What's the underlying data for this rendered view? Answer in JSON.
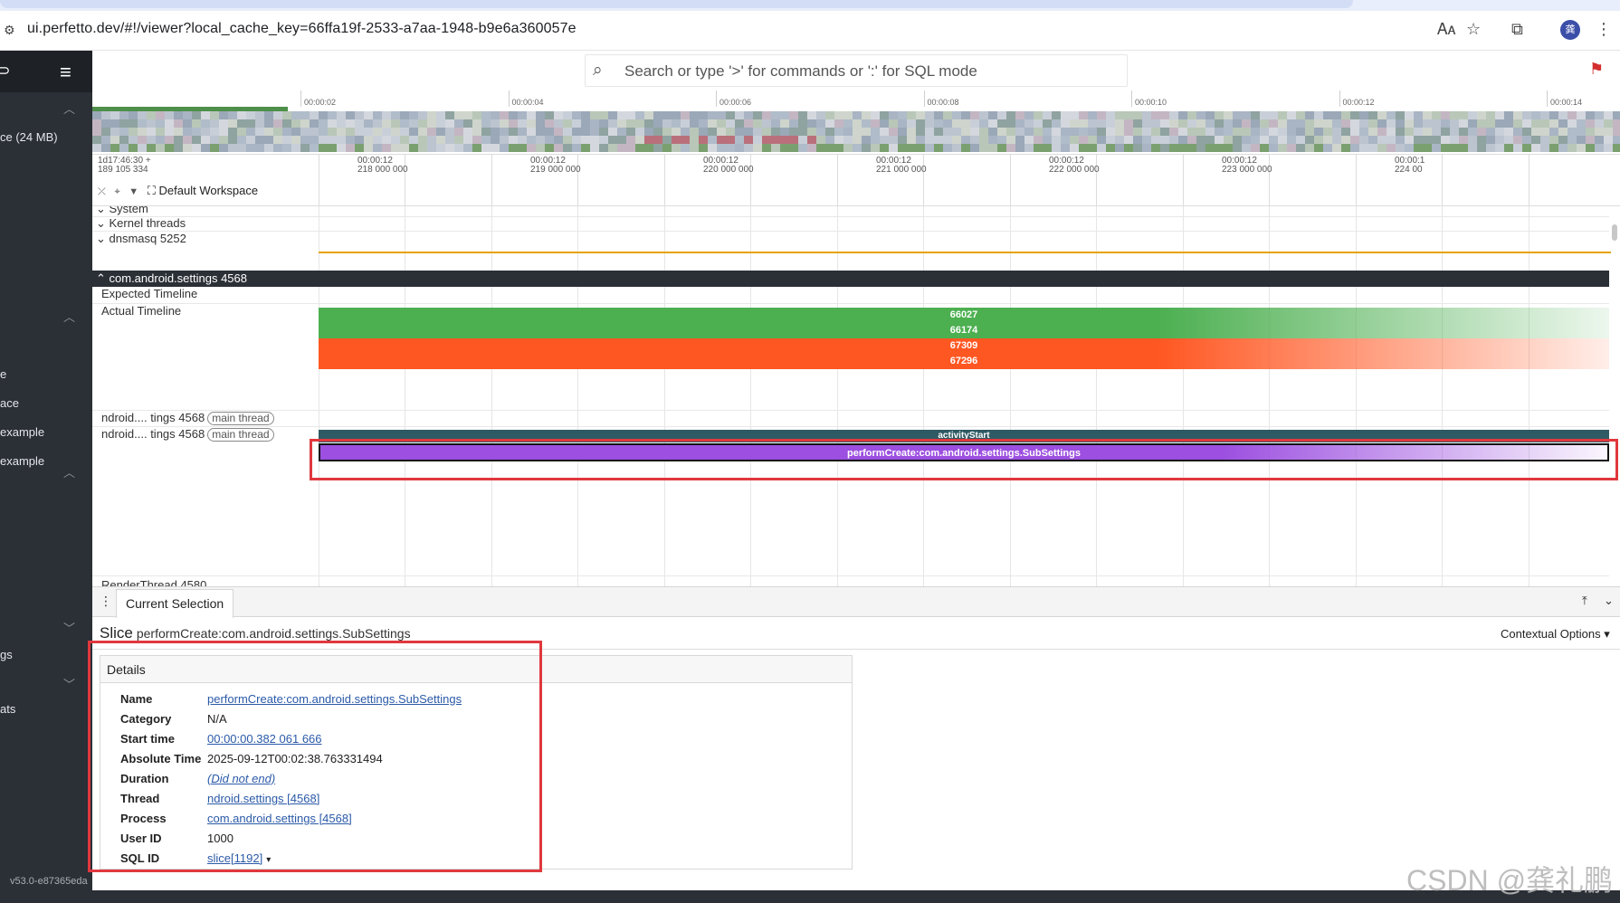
{
  "browser": {
    "url": "ui.perfetto.dev/#!/viewer?local_cache_key=66ffa19f-2533-a7aa-1948-b9e6a360057e",
    "avatar_letter": "龚"
  },
  "sidebar": {
    "items": [
      {
        "label": "ce (24 MB)"
      },
      {
        "label": "e"
      },
      {
        "label": "ace"
      },
      {
        "label": "example"
      },
      {
        "label": "example"
      },
      {
        "label": "gs"
      },
      {
        "label": "ats"
      }
    ],
    "version": "v53.0-e87365eda"
  },
  "omnibox": {
    "placeholder": "Search or type '>' for commands or ':' for SQL mode"
  },
  "overview": {
    "ticks": [
      "00:00:02",
      "00:00:04",
      "00:00:06",
      "00:00:08",
      "00:00:10",
      "00:00:12",
      "00:00:14"
    ]
  },
  "timeaxis": {
    "origin_line1": "1d17:46:30 +",
    "origin_line2": "189 105 334",
    "ticks": [
      {
        "l1": "00:00:12",
        "l2": "218 000 000"
      },
      {
        "l1": "00:00:12",
        "l2": "219 000 000"
      },
      {
        "l1": "00:00:12",
        "l2": "220 000 000"
      },
      {
        "l1": "00:00:12",
        "l2": "221 000 000"
      },
      {
        "l1": "00:00:12",
        "l2": "222 000 000"
      },
      {
        "l1": "00:00:12",
        "l2": "223 000 000"
      },
      {
        "l1": "00:00:1",
        "l2": "224 00"
      }
    ],
    "workspace": "Default Workspace"
  },
  "tracks": {
    "system": "System",
    "kernel": "Kernel threads",
    "dnsmasq": "dnsmasq 5252",
    "process": "com.android.settings 4568",
    "expected": "Expected Timeline",
    "actual": "Actual Timeline",
    "actual_slices": [
      "66027",
      "66174",
      "67309",
      "67296"
    ],
    "thread1": "ndroid.... tings 4568",
    "thread2": "ndroid.... tings 4568",
    "thread_pill": "main thread",
    "activity_slice": "activityStart",
    "perform_slice": "performCreate:com.android.settings.SubSettings",
    "render_thread": "RenderThread 4580"
  },
  "details": {
    "tab": "Current Selection",
    "slice_word": "Slice",
    "slice_name": "performCreate:com.android.settings.SubSettings",
    "contextual": "Contextual Options",
    "card_title": "Details",
    "rows": [
      {
        "k": "Name",
        "v": "performCreate:com.android.settings.SubSettings",
        "link": true
      },
      {
        "k": "Category",
        "v": "N/A",
        "link": false
      },
      {
        "k": "Start time",
        "v": "00:00:00.382 061 666",
        "link": true
      },
      {
        "k": "Absolute Time",
        "v": "2025-09-12T00:02:38.763331494",
        "link": false
      },
      {
        "k": "Duration",
        "v": "(Did not end)",
        "link": true,
        "italic": true
      },
      {
        "k": "Thread",
        "v": "ndroid.settings [4568]",
        "link": true
      },
      {
        "k": "Process",
        "v": "com.android.settings [4568]",
        "link": true
      },
      {
        "k": "User ID",
        "v": "1000",
        "link": false
      },
      {
        "k": "SQL ID",
        "v": "slice[1192]",
        "link": true,
        "dropdown": "▾"
      }
    ]
  },
  "watermark": "CSDN @龚礼鹏",
  "colors": {
    "green_slice": "#4caf50",
    "orange_slice": "#ff5722",
    "purple_slice": "#9c4fe0",
    "activity_slice": "#2e5a63",
    "highlight_box": "#e0383e"
  }
}
